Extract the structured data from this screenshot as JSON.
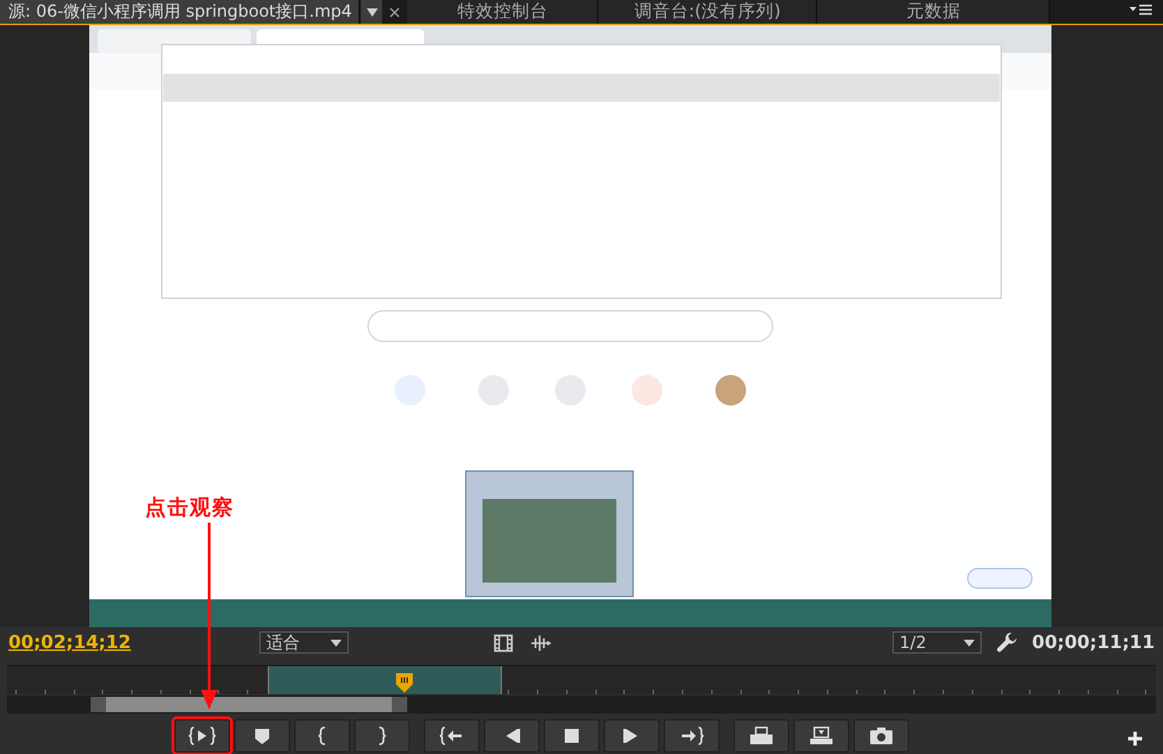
{
  "panel_tabs": [
    {
      "label": "源: 06-微信小程序调用 springboot接口.mp4",
      "selected": true,
      "has_menu": true
    },
    {
      "label": "特效控制台",
      "selected": false,
      "has_menu": false
    },
    {
      "label": "调音台:(没有序列)",
      "selected": false,
      "has_menu": false
    },
    {
      "label": "元数据",
      "selected": false,
      "has_menu": false
    }
  ],
  "annotation": {
    "text": "点击观察"
  },
  "current_timecode": "00;02;14;12",
  "zoom_dropdown": "适合",
  "resolution_dropdown": "1/2",
  "duration_timecode": "00;00;11;11",
  "transport_buttons": [
    {
      "kind": "play-in-out",
      "annotated": true
    },
    {
      "kind": "marker",
      "annotated": false
    },
    {
      "kind": "mark-in",
      "annotated": false
    },
    {
      "kind": "mark-out",
      "annotated": false
    },
    {
      "kind": "go-in",
      "annotated": false
    },
    {
      "kind": "step-back",
      "annotated": false
    },
    {
      "kind": "stop",
      "annotated": false
    },
    {
      "kind": "step-forward",
      "annotated": false
    },
    {
      "kind": "go-out",
      "annotated": false
    },
    {
      "kind": "insert",
      "annotated": false
    },
    {
      "kind": "overlay",
      "annotated": false
    },
    {
      "kind": "export-frame",
      "annotated": false
    }
  ]
}
